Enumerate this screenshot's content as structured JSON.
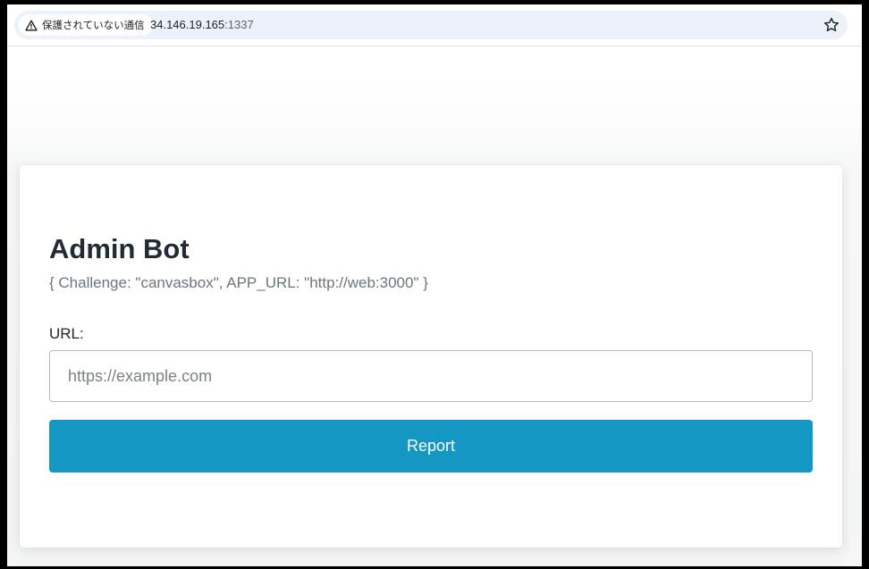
{
  "browser": {
    "security_label": "保護されていない通信",
    "url_host": "34.146.19.165",
    "url_port": ":1337",
    "icons": {
      "warning": "warning-triangle-icon",
      "bookmark": "star-icon"
    }
  },
  "page": {
    "title": "Admin Bot",
    "subtitle": "{ Challenge: \"canvasbox\", APP_URL: \"http://web:3000\" }",
    "url_label": "URL:",
    "url_input": {
      "value": "",
      "placeholder": "https://example.com"
    },
    "report_label": "Report"
  },
  "colors": {
    "accent": "#1497c2",
    "title_text": "#212b36",
    "muted_text": "#6c757d"
  }
}
